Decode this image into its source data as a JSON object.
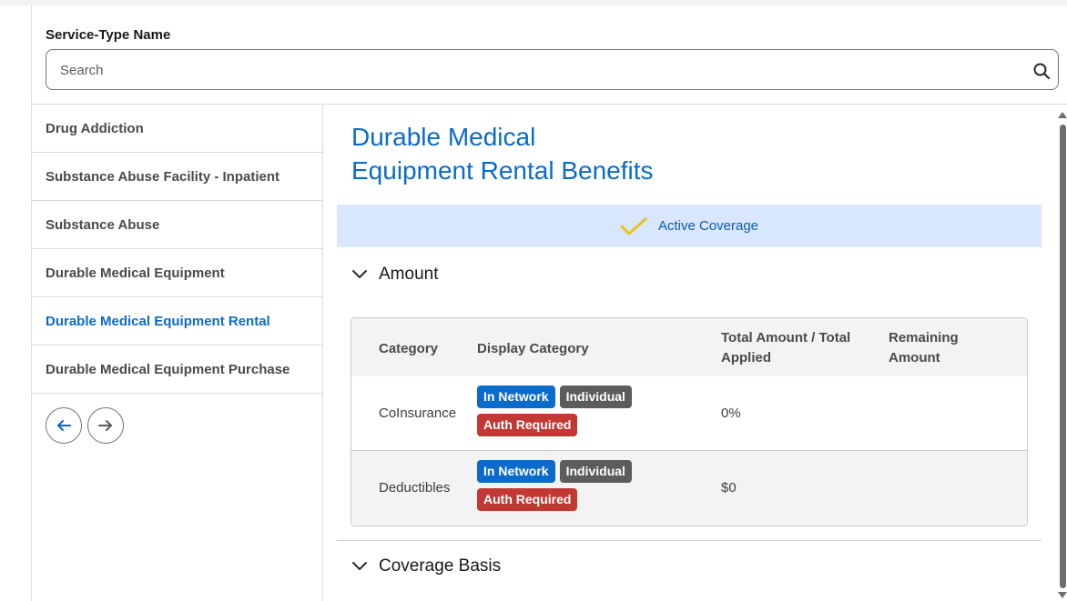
{
  "search": {
    "label": "Service-Type Name",
    "placeholder": "Search",
    "value": ""
  },
  "sidebar": {
    "items": [
      {
        "label": "Drug Addiction",
        "active": false
      },
      {
        "label": "Substance Abuse Facility - Inpatient",
        "active": false
      },
      {
        "label": "Substance Abuse",
        "active": false
      },
      {
        "label": "Durable Medical Equipment",
        "active": false
      },
      {
        "label": "Durable Medical Equipment Rental",
        "active": true
      },
      {
        "label": "Durable Medical Equipment Purchase",
        "active": false
      }
    ]
  },
  "main": {
    "title_line1": "Durable Medical",
    "title_line2": "Equipment Rental Benefits",
    "status": "Active Coverage",
    "sections": {
      "amount": "Amount",
      "coverage_basis": "Coverage Basis"
    },
    "table": {
      "headers": {
        "category": "Category",
        "display_category": "Display Category",
        "total_amount_line1": "Total Amount / Total",
        "total_amount_line2": "Applied",
        "remaining_line1": "Remaining",
        "remaining_line2": "Amount"
      },
      "rows": [
        {
          "category": "CoInsurance",
          "badges": {
            "network": "In Network",
            "level": "Individual",
            "auth": "Auth Required"
          },
          "total": "0%"
        },
        {
          "category": "Deductibles",
          "badges": {
            "network": "In Network",
            "level": "Individual",
            "auth": "Auth Required"
          },
          "total": "$0"
        }
      ]
    }
  },
  "colors": {
    "accent": "#0b6bcb",
    "status_bg": "#d8e6fe",
    "check": "#e8c31b",
    "badge_blue": "#0b6bcb",
    "badge_grey": "#5c5c5c",
    "badge_red": "#c23934"
  },
  "icons": {
    "search": "search-icon",
    "prev": "arrow-left-icon",
    "next": "arrow-right-icon",
    "check": "checkmark-icon",
    "chevron": "chevron-down-icon"
  }
}
